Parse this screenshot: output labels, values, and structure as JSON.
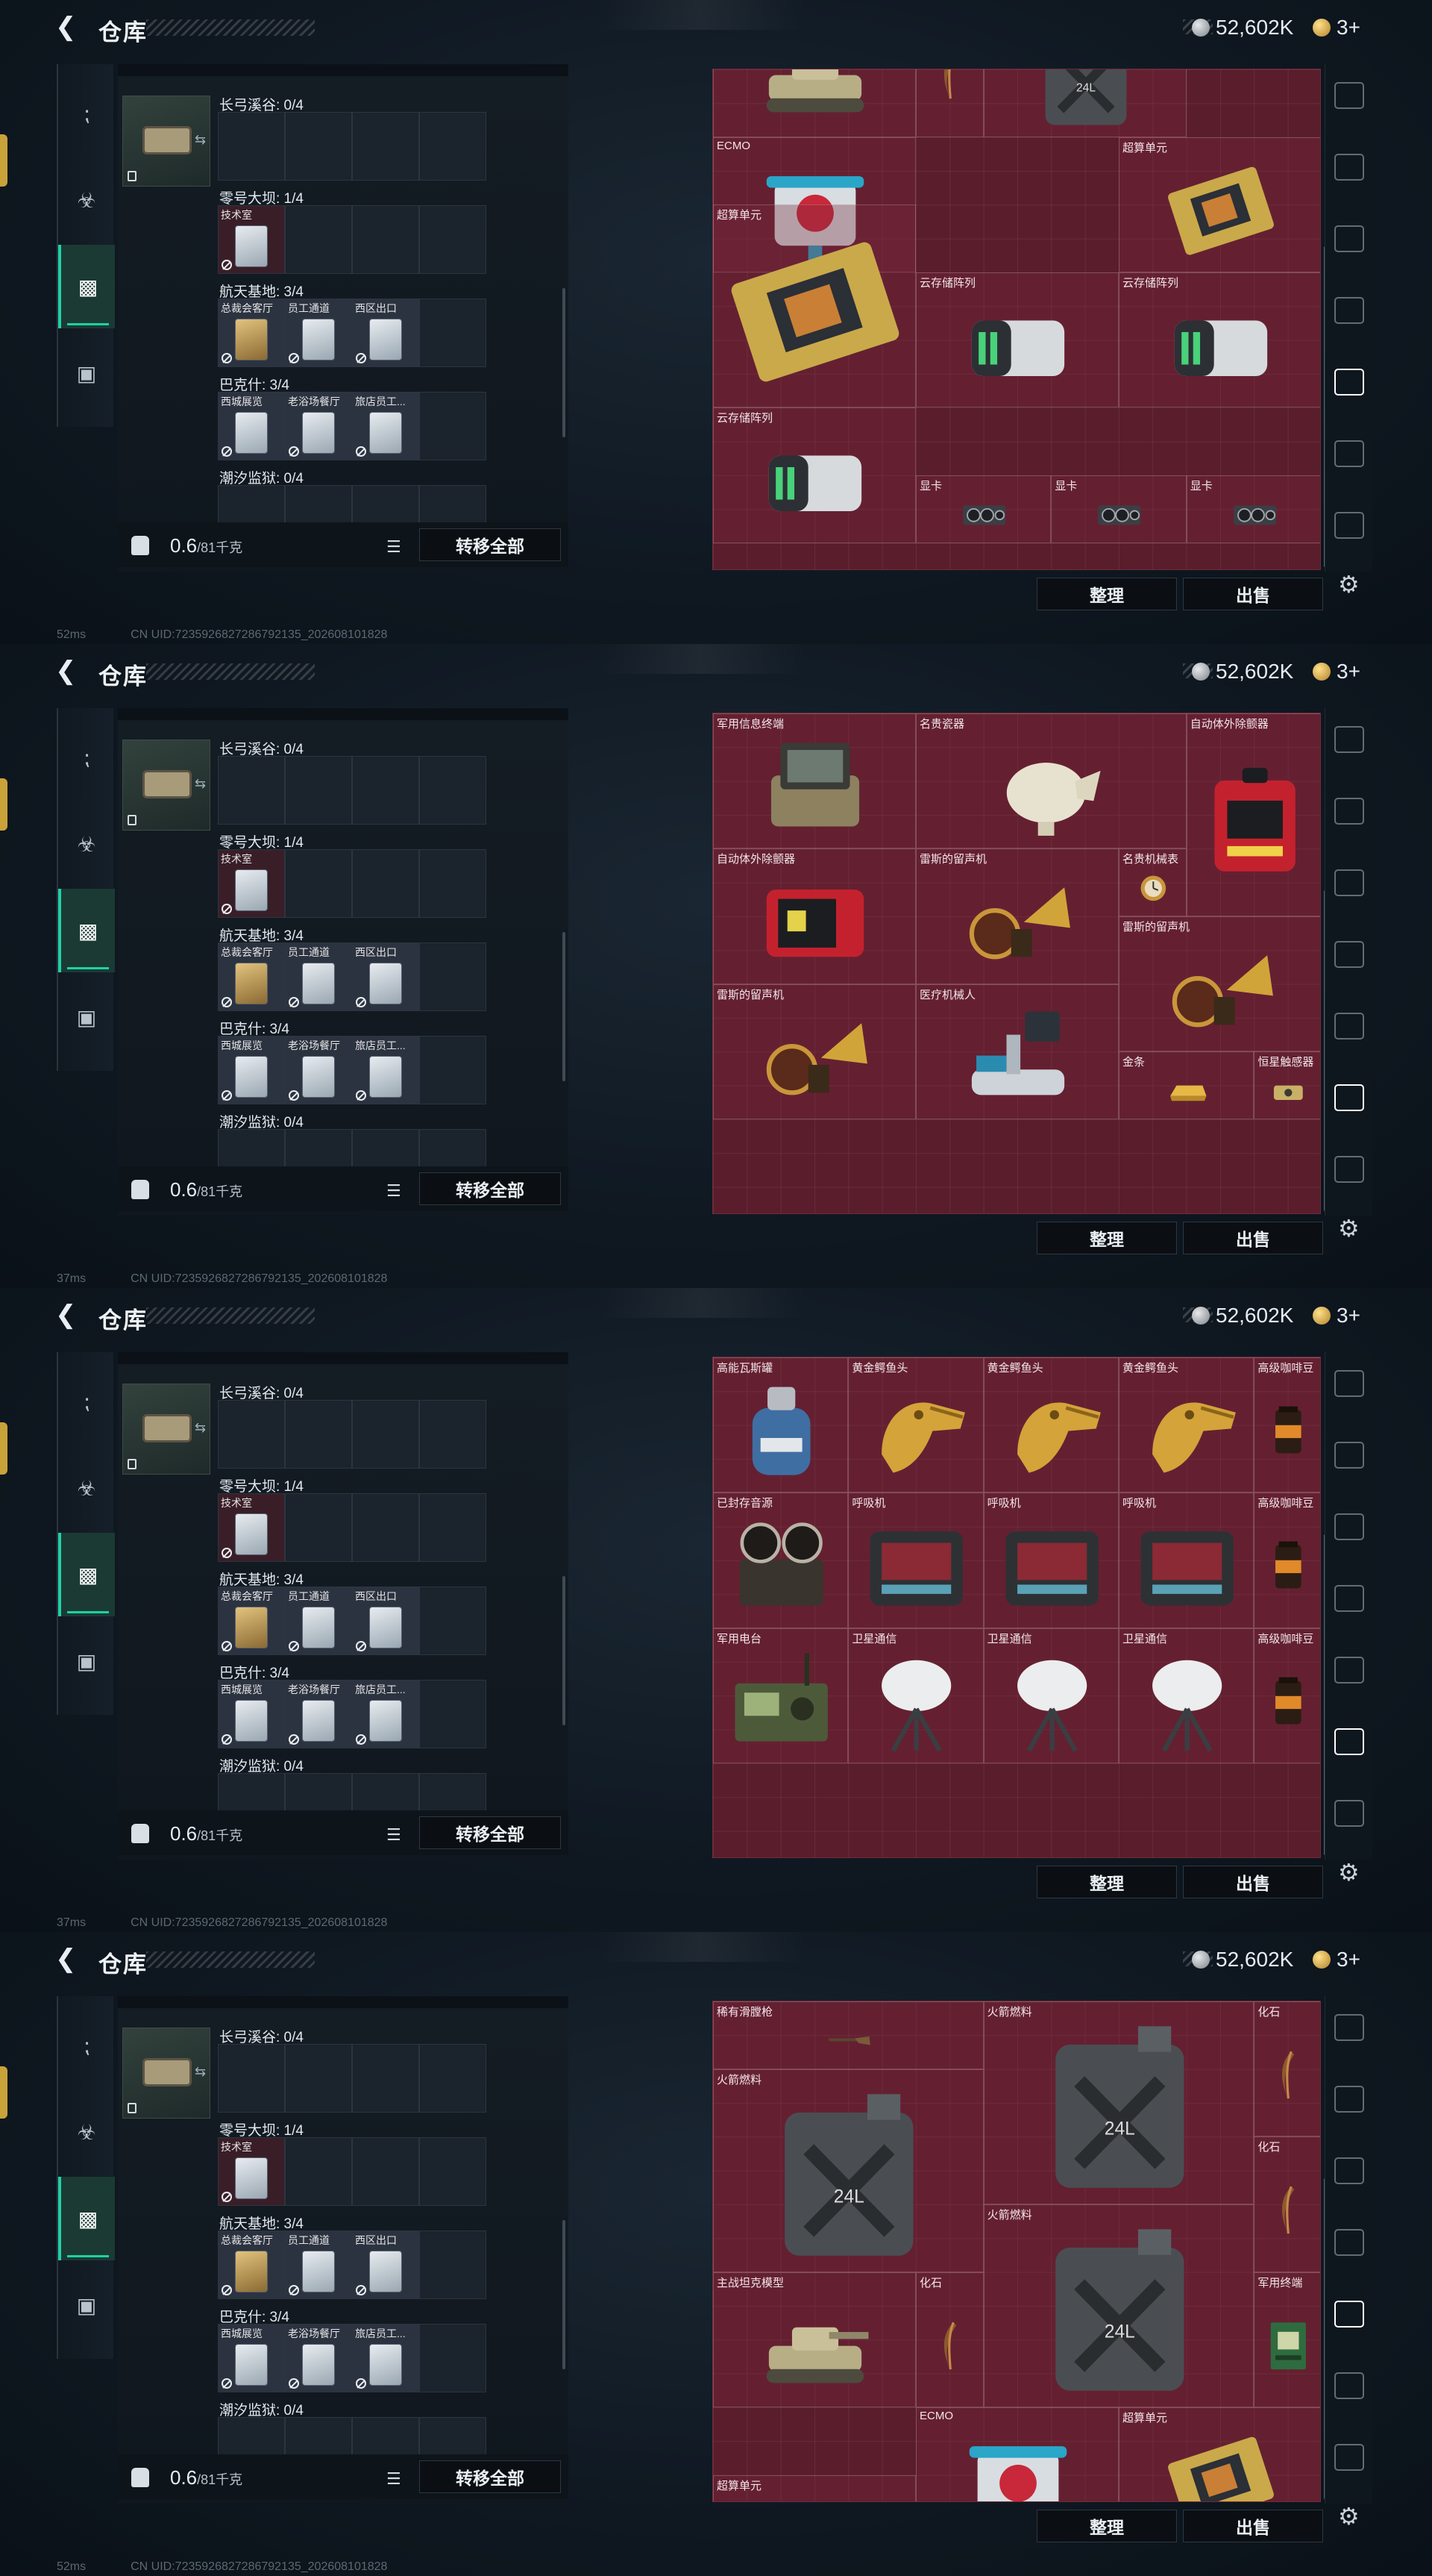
{
  "topbar": {
    "title": "仓库",
    "silver": "52,602K",
    "gold": "3+"
  },
  "loadout": {
    "sections": [
      {
        "label": "长弓溪谷: 0/4",
        "slots": []
      },
      {
        "label": "零号大坝: 1/4",
        "slots": [
          "技术室"
        ]
      },
      {
        "label": "航天基地: 3/4",
        "slots": [
          "总裁会客厅",
          "员工通道",
          "西区出口"
        ]
      },
      {
        "label": "巴克什: 3/4",
        "slots": [
          "西城展览",
          "老浴场餐厅",
          "旅店员工..."
        ]
      },
      {
        "label": "潮汐监狱: 0/4",
        "slots": []
      }
    ],
    "weight": "0.6",
    "weight_unit": "/81千克",
    "transfer_all": "转移全部"
  },
  "actions": {
    "sort": "整理",
    "sell": "出售"
  },
  "status": "CN UID:7235926827286792135_202608101828",
  "pings": [
    "52ms",
    "37ms",
    "37ms",
    "52ms"
  ],
  "icons": {
    "back": "back-arrow-icon",
    "weight": "weight-icon",
    "list": "list-icon",
    "settings": "gear-icon"
  },
  "colors": {
    "grid": "#5a1d2c",
    "accent": "#1fd1a4",
    "gold": "#c9a23a"
  },
  "grids": [
    {
      "items": [
        {
          "name": "主战坦克模型",
          "art": "tank"
        },
        {
          "name": "化石",
          "art": "fossil"
        },
        {
          "name": "火箭燃料",
          "art": "fuel"
        },
        {
          "name": "军用终端",
          "art": "board"
        },
        {
          "name": "ECMO",
          "art": "ecmo"
        },
        {
          "name": "超算单元",
          "art": "gpu"
        },
        {
          "name": "超算单元",
          "art": "gpu"
        },
        {
          "name": "云存储阵列",
          "art": "server"
        },
        {
          "name": "云存储阵列",
          "art": "server"
        },
        {
          "name": "云存储阵列",
          "art": "server"
        },
        {
          "name": "显卡",
          "art": "card"
        },
        {
          "name": "显卡",
          "art": "card"
        },
        {
          "name": "显卡",
          "art": "card"
        }
      ]
    },
    {
      "items": [
        {
          "name": "军用信息终端",
          "art": "terminal"
        },
        {
          "name": "名贵瓷器",
          "art": "vase"
        },
        {
          "name": "自动体外除颤器",
          "art": "aed"
        },
        {
          "name": "自动体外除颤器",
          "art": "aed2"
        },
        {
          "name": "雷斯的留声机",
          "art": "phono"
        },
        {
          "name": "名贵机械表",
          "art": "watch"
        },
        {
          "name": "雷斯的留声机",
          "art": "phono"
        },
        {
          "name": "雷斯的留声机",
          "art": "phono"
        },
        {
          "name": "医疗机械人",
          "art": "robot"
        },
        {
          "name": "金条",
          "art": "goldbar"
        },
        {
          "name": "恒星触感器",
          "art": "sensor"
        }
      ]
    },
    {
      "items": [
        {
          "name": "高能瓦斯罐",
          "art": "gas"
        },
        {
          "name": "黄金鳄鱼头",
          "art": "croc"
        },
        {
          "name": "黄金鳄鱼头",
          "art": "croc"
        },
        {
          "name": "黄金鳄鱼头",
          "art": "croc"
        },
        {
          "name": "高级咖啡豆",
          "art": "coffee"
        },
        {
          "name": "已封存音源",
          "art": "reel"
        },
        {
          "name": "呼吸机",
          "art": "vent"
        },
        {
          "name": "呼吸机",
          "art": "vent"
        },
        {
          "name": "呼吸机",
          "art": "vent"
        },
        {
          "name": "高级咖啡豆",
          "art": "coffee"
        },
        {
          "name": "军用电台",
          "art": "radio"
        },
        {
          "name": "卫星通信",
          "art": "dish"
        },
        {
          "name": "卫星通信",
          "art": "dish"
        },
        {
          "name": "卫星通信",
          "art": "dish"
        },
        {
          "name": "高级咖啡豆",
          "art": "coffee"
        }
      ]
    },
    {
      "items": [
        {
          "name": "稀有滑膛枪",
          "art": "musket"
        },
        {
          "name": "火箭燃料",
          "art": "fuel"
        },
        {
          "name": "化石",
          "art": "fossil"
        },
        {
          "name": "火箭燃料",
          "art": "fuel"
        },
        {
          "name": "化石",
          "art": "fossil"
        },
        {
          "name": "火箭燃料",
          "art": "fuel"
        },
        {
          "name": "主战坦克模型",
          "art": "tank"
        },
        {
          "name": "化石",
          "art": "fossil"
        },
        {
          "name": "军用终端",
          "art": "board"
        },
        {
          "name": "ECMO",
          "art": "ecmo"
        },
        {
          "name": "超算单元",
          "art": "gpu"
        },
        {
          "name": "超算单元",
          "art": "gpu"
        }
      ]
    }
  ]
}
